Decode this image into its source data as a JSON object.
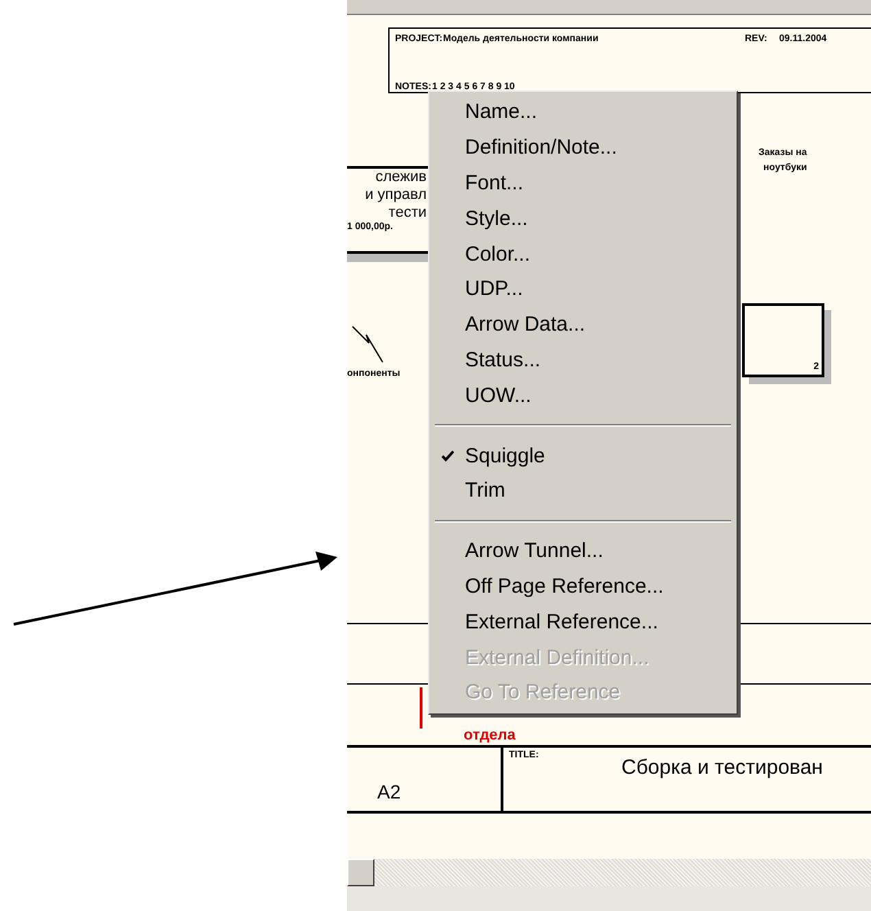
{
  "diagram": {
    "project_label": "PROJECT:",
    "project": "Модель деятельности компании",
    "rev_label": "REV:",
    "rev": "09.11.2004",
    "notes_label": "NOTES:",
    "notes": "1 2 3 4 5 6 7 8 9 10",
    "left_box_lines": [
      "слежив",
      "и управл",
      "тести"
    ],
    "left_box_cost": "1 000,00р.",
    "left_arrow_label": "онпоненты",
    "right_labels": [
      "Заказы на",
      "ноутбуки"
    ],
    "right_box_number": "2",
    "red_label": "отдела",
    "title_label": "TITLE:",
    "title": "Сборка и тестирован",
    "node": "A2"
  },
  "context_menu": [
    {
      "kind": "item",
      "label": "Name...",
      "checked": false,
      "disabled": false
    },
    {
      "kind": "item",
      "label": "Definition/Note...",
      "checked": false,
      "disabled": false
    },
    {
      "kind": "item",
      "label": "Font...",
      "checked": false,
      "disabled": false
    },
    {
      "kind": "item",
      "label": "Style...",
      "checked": false,
      "disabled": false
    },
    {
      "kind": "item",
      "label": "Color...",
      "checked": false,
      "disabled": false
    },
    {
      "kind": "item",
      "label": "UDP...",
      "checked": false,
      "disabled": false
    },
    {
      "kind": "item",
      "label": "Arrow Data...",
      "checked": false,
      "disabled": false
    },
    {
      "kind": "item",
      "label": "Status...",
      "checked": false,
      "disabled": false
    },
    {
      "kind": "item",
      "label": "UOW...",
      "checked": false,
      "disabled": false
    },
    {
      "kind": "separator"
    },
    {
      "kind": "item",
      "label": "Squiggle",
      "checked": true,
      "disabled": false
    },
    {
      "kind": "item",
      "label": "Trim",
      "checked": false,
      "disabled": false
    },
    {
      "kind": "separator"
    },
    {
      "kind": "item",
      "label": "Arrow Tunnel...",
      "checked": false,
      "disabled": false
    },
    {
      "kind": "item",
      "label": "Off Page Reference...",
      "checked": false,
      "disabled": false
    },
    {
      "kind": "item",
      "label": "External Reference...",
      "checked": false,
      "disabled": false
    },
    {
      "kind": "item",
      "label": "External Definition...",
      "checked": false,
      "disabled": true
    },
    {
      "kind": "item",
      "label": "Go To Reference",
      "checked": false,
      "disabled": true
    }
  ]
}
